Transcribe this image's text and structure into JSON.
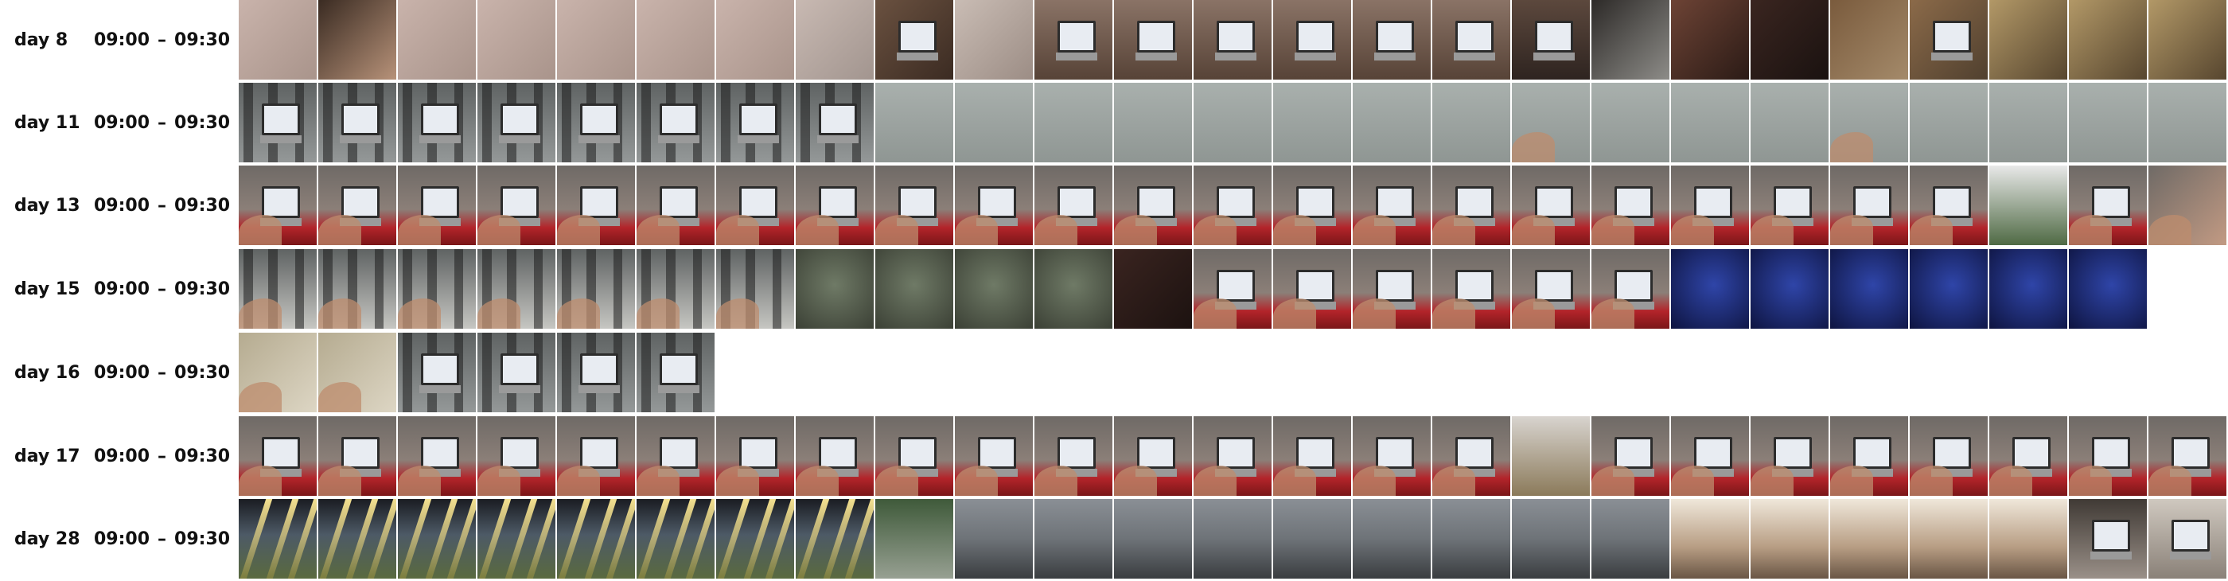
{
  "rows": [
    {
      "day": "day 8",
      "from": "09:00",
      "to": "09:30",
      "frames": [
        "wall",
        "hand",
        "wall",
        "wall",
        "wall",
        "wall",
        "wall",
        "wall-note",
        "room-laptop",
        "door",
        "laptop",
        "laptop",
        "laptop",
        "laptop",
        "laptop",
        "laptop",
        "laptop-dark",
        "doorway",
        "window",
        "dark-room",
        "balcony",
        "laptop-balcony",
        "lamp",
        "lamp",
        "lamp"
      ]
    },
    {
      "day": "day 11",
      "from": "09:00",
      "to": "09:30",
      "frames": [
        "bed-laptop",
        "bed-laptop",
        "bed-laptop",
        "bed-laptop",
        "bed-laptop",
        "bed-laptop",
        "bed-laptop",
        "bed-laptop",
        "grey",
        "grey",
        "grey",
        "grey",
        "grey",
        "grey",
        "grey",
        "grey",
        "grey-hand",
        "grey",
        "grey",
        "grey",
        "grey-hand",
        "grey",
        "grey",
        "grey",
        "grey"
      ]
    },
    {
      "day": "day 13",
      "from": "09:00",
      "to": "09:30",
      "frames": [
        "red-laptop",
        "red-laptop",
        "red-laptop",
        "red-laptop",
        "red-laptop",
        "red-laptop",
        "red-laptop",
        "red-laptop",
        "red-laptop",
        "red-laptop",
        "red-laptop",
        "red-laptop",
        "red-laptop",
        "red-laptop",
        "red-laptop",
        "red-laptop",
        "red-laptop",
        "red-laptop",
        "red-laptop",
        "red-laptop",
        "red-laptop",
        "red-laptop",
        "tree",
        "red-laptop",
        "arm"
      ]
    },
    {
      "day": "day 15",
      "from": "09:00",
      "to": "09:30",
      "frames": [
        "bed-arm",
        "bed-arm",
        "bed-arm",
        "bed-arm",
        "bed-arm",
        "bed-arm",
        "bed-arm",
        "blur",
        "blur",
        "blur",
        "blur",
        "dark",
        "red-laptop",
        "red-laptop",
        "red-laptop",
        "red-laptop",
        "red-laptop",
        "red-laptop",
        "blue",
        "blue",
        "blue",
        "blue",
        "blue",
        "blue"
      ]
    },
    {
      "day": "day 16",
      "from": "09:00",
      "to": "09:30",
      "frames": [
        "paper",
        "paper",
        "bed-laptop",
        "bed-laptop",
        "bed-laptop",
        "bed-laptop"
      ]
    },
    {
      "day": "day 17",
      "from": "09:00",
      "to": "09:30",
      "frames": [
        "red-laptop",
        "red-laptop",
        "red-laptop",
        "red-laptop",
        "red-laptop",
        "red-laptop",
        "red-laptop",
        "red-laptop",
        "red-laptop",
        "red-laptop",
        "red-laptop",
        "red-laptop",
        "red-laptop",
        "red-laptop",
        "red-laptop",
        "red-laptop",
        "poster",
        "red-laptop",
        "red-laptop",
        "red-laptop",
        "red-laptop",
        "red-laptop",
        "red-laptop",
        "red-laptop",
        "red-laptop"
      ]
    },
    {
      "day": "day 28",
      "from": "09:00",
      "to": "09:30",
      "frames": [
        "bus",
        "bus",
        "bus",
        "bus",
        "bus",
        "bus",
        "bus",
        "bus",
        "tree-street",
        "street",
        "street",
        "street",
        "street",
        "street",
        "street",
        "street",
        "street",
        "street",
        "office",
        "office",
        "office",
        "office",
        "office",
        "office-dark",
        "office-laptop"
      ]
    }
  ],
  "frame_styles": {
    "wall": {
      "bg": "linear-gradient(135deg,#c9b3ab,#a9948b)"
    },
    "hand": {
      "bg": "linear-gradient(135deg,#3a2b22,#b79279)"
    },
    "wall-note": {
      "bg": "linear-gradient(135deg,#c8b9b2,#a2958f)"
    },
    "room-laptop": {
      "bg": "linear-gradient(135deg,#6a5140,#3b2b22)",
      "laptop": true
    },
    "door": {
      "bg": "linear-gradient(135deg,#c9bcb4,#9c8d85)"
    },
    "laptop": {
      "bg": "linear-gradient(180deg,#8a7366,#574337)",
      "laptop": true
    },
    "laptop-dark": {
      "bg": "linear-gradient(180deg,#5c483d,#2e2420)",
      "laptop": true
    },
    "doorway": {
      "bg": "linear-gradient(135deg,#2d2a28,#8d8c88)"
    },
    "window": {
      "bg": "linear-gradient(135deg,#6d4335,#2b1b16)"
    },
    "dark-room": {
      "bg": "linear-gradient(135deg,#3a2520,#1a1210)"
    },
    "balcony": {
      "bg": "linear-gradient(135deg,#7a5b3d,#a48a6a)"
    },
    "laptop-balcony": {
      "bg": "linear-gradient(135deg,#8b6a49,#50402f)",
      "laptop": true
    },
    "lamp": {
      "bg": "linear-gradient(135deg,#b29867,#57462f)"
    },
    "bed-laptop": {
      "bg": "linear-gradient(180deg,#5f6363,#949898)",
      "laptop": true,
      "bars": true
    },
    "grey": {
      "bg": "linear-gradient(180deg,#a9b0ad,#8f9693)"
    },
    "grey-hand": {
      "bg": "linear-gradient(180deg,#a9b0ad,#8f9693)",
      "blob": true
    },
    "red-laptop": {
      "bg": "linear-gradient(180deg,#6f6a66 0%,#8b7f78 55%,#b3242a 78%,#7a1618 100%)",
      "laptop": true,
      "blob": true
    },
    "tree": {
      "bg": "linear-gradient(180deg,#e8e8e8,#4f6a44)"
    },
    "arm": {
      "bg": "linear-gradient(135deg,#6f6a66,#c29a83)",
      "blob": true
    },
    "bed-arm": {
      "bg": "linear-gradient(180deg,#5f6363,#c6c6c2)",
      "bars": true,
      "blob": true
    },
    "blur": {
      "bg": "radial-gradient(circle at 50% 45%,#6f7a66,#3b4035)"
    },
    "dark": {
      "bg": "linear-gradient(135deg,#3a2420,#1c1210)"
    },
    "blue": {
      "bg": "radial-gradient(circle at 55% 45%,#2f45a8,#0e1440)"
    },
    "paper": {
      "bg": "linear-gradient(135deg,#b5ab90,#ddd6c4)",
      "blob": true
    },
    "poster": {
      "bg": "linear-gradient(180deg,#d8d4cf,#8b7a5a)"
    },
    "bus": {
      "bg": "linear-gradient(180deg,#1a1c22 0%,#4d5a66 45%,#5a6a3f 100%)",
      "lights": true
    },
    "tree-street": {
      "bg": "linear-gradient(180deg,#3f5a3a,#97a092)"
    },
    "street": {
      "bg": "linear-gradient(180deg,#8a8f95 0%,#6e7378 50%,#3a3d40 100%)"
    },
    "office": {
      "bg": "linear-gradient(180deg,#efe7da 0%,#b89e84 60%,#6a5645 100%)"
    },
    "office-dark": {
      "bg": "linear-gradient(180deg,#403a35,#9a9088)",
      "laptop": true
    },
    "office-laptop": {
      "bg": "linear-gradient(180deg,#cfc8bf,#8a8178)",
      "laptop": true
    }
  }
}
